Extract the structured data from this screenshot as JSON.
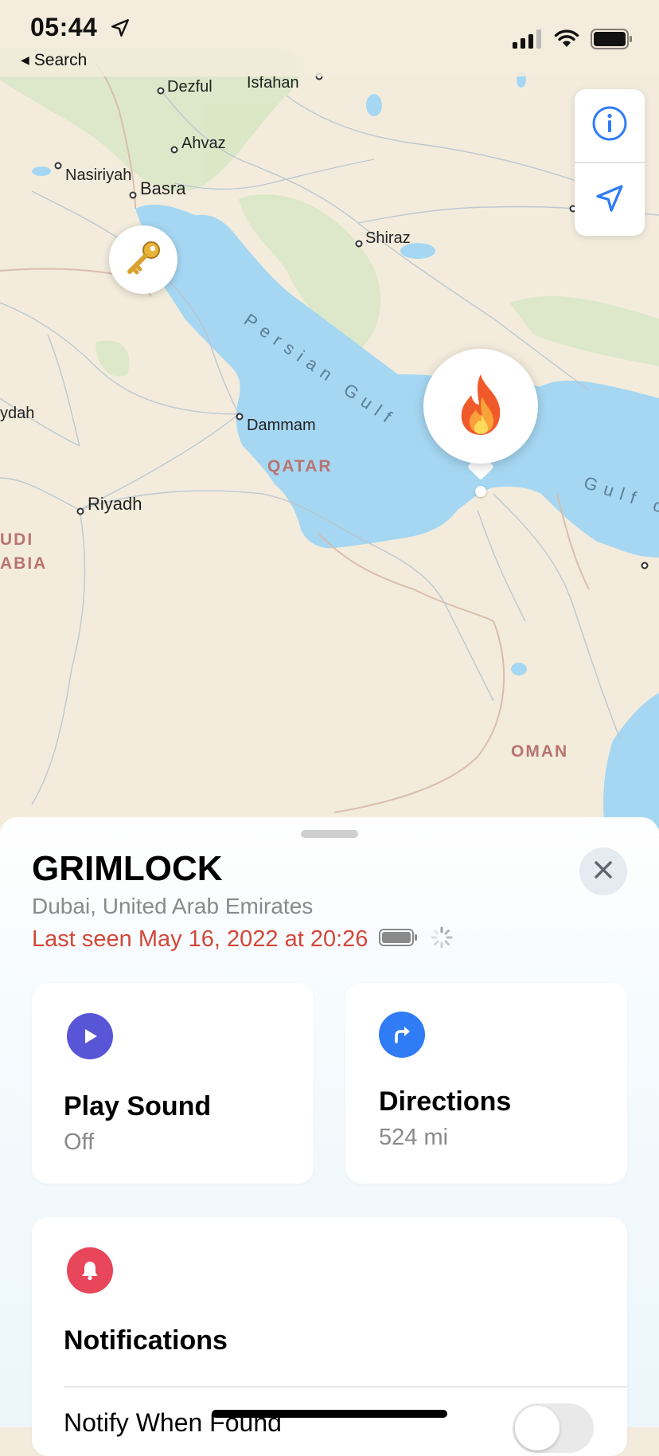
{
  "status_bar": {
    "time": "05:44",
    "back_label": "Search",
    "icons": [
      "location-arrow-icon",
      "signal-icon",
      "wifi-icon",
      "battery-icon"
    ]
  },
  "map": {
    "cities": {
      "dezful": "Dezful",
      "isfahan": "Isfahan",
      "ahvaz": "Ahvaz",
      "nasiriyah": "Nasiriyah",
      "basra": "Basra",
      "shiraz": "Shiraz",
      "dammam": "Dammam",
      "riyadh": "Riyadh",
      "ydah": "ydah"
    },
    "countries": {
      "qatar": "QATAR",
      "saudi_1": "UDI",
      "saudi_2": "ABIA",
      "oman": "OMAN"
    },
    "water": {
      "persian_gulf": "Persian Gulf",
      "gulf_of": "Gulf o"
    },
    "pins": {
      "small": "key-emoji",
      "large": "fire-emoji"
    },
    "controls": [
      "info-icon",
      "location-arrow-icon"
    ]
  },
  "sheet": {
    "device_name": "GRIMLOCK",
    "location": "Dubai, United Arab Emirates",
    "last_seen": "Last seen May 16, 2022 at 20:26",
    "actions": {
      "play_sound": {
        "title": "Play Sound",
        "status": "Off"
      },
      "directions": {
        "title": "Directions",
        "distance": "524 mi"
      }
    },
    "notifications": {
      "title": "Notifications",
      "notify_when_found": "Notify When Found",
      "notify_when_found_enabled": false
    }
  },
  "colors": {
    "play_accent": "#5856d6",
    "directions_accent": "#2f7cf6",
    "notifications_accent": "#e8465a",
    "last_seen_red": "#d3473a",
    "water": "#a6d7f2",
    "land": "#f3ecdc"
  }
}
